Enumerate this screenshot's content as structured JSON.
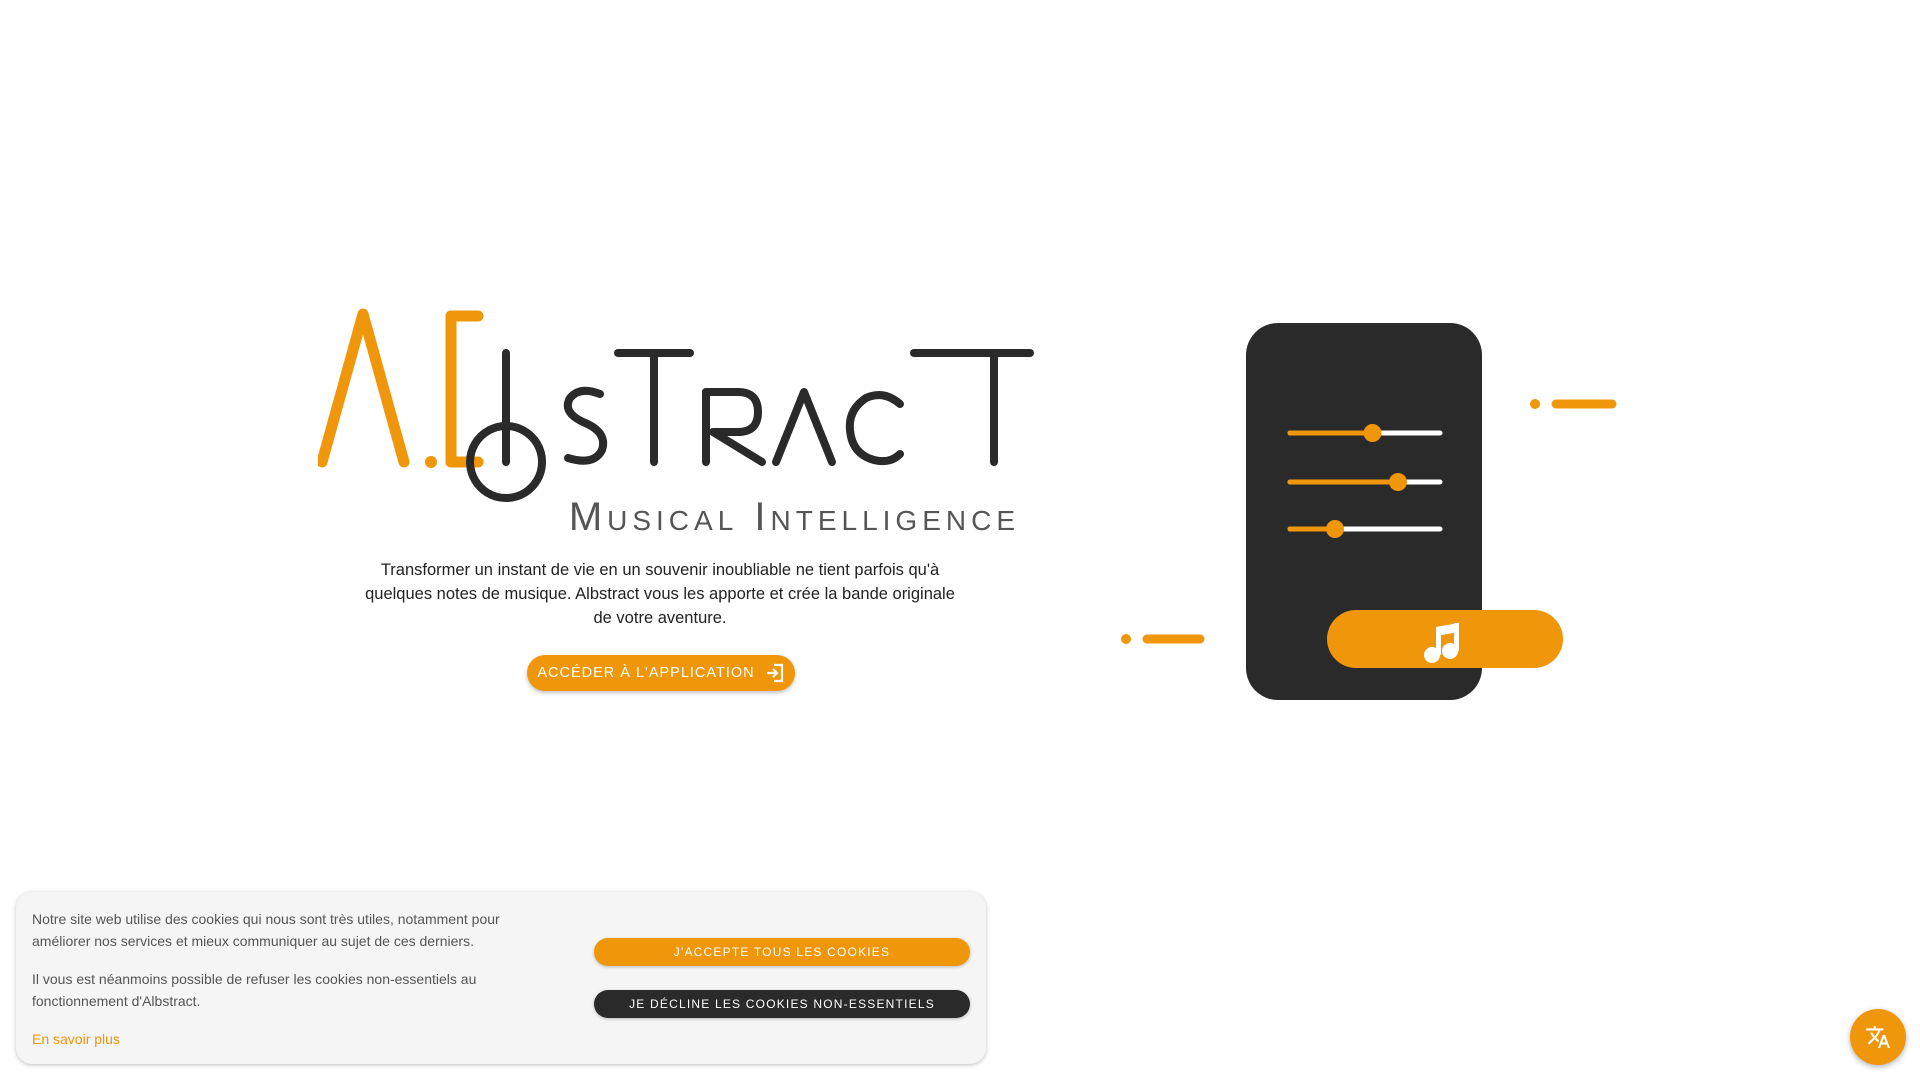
{
  "brand": {
    "logo_text": "AIbsTRAcT",
    "tagline": "Musical Intelligence",
    "accent_color": "#f0960a",
    "dark_color": "#2a2a2a"
  },
  "hero": {
    "description_lines": [
      "Transformer un instant de vie en un souvenir inoubliable ne tient parfois qu'à",
      "quelques notes de musique. Albstract vous les apporte et crée la bande originale",
      "de votre aventure."
    ],
    "cta_label": "Accéder à l'application",
    "cta_icon": "login-icon"
  },
  "illustration": {
    "sliders": [
      0.55,
      0.72,
      0.3
    ],
    "play_icon": "music-note-icon"
  },
  "cookie_banner": {
    "paragraph_1": "Notre site web utilise des cookies qui nous sont très utiles, notamment pour améliorer nos services et mieux communiquer au sujet de ces derniers.",
    "paragraph_2": "Il vous est néanmoins possible de refuser les cookies non-essentiels au fonctionnement d'Albstract.",
    "learn_more": "En savoir plus",
    "accept_label": "J'accepte tous les cookies",
    "decline_label": "Je décline les cookies non-essentiels"
  },
  "language_button": {
    "icon": "translate-icon"
  }
}
